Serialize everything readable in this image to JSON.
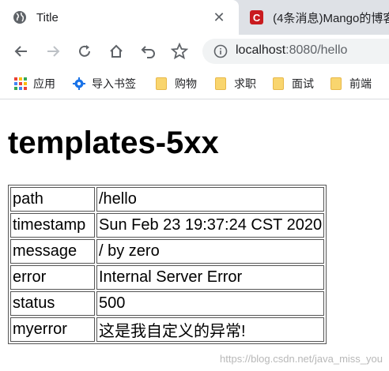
{
  "tabs": [
    {
      "title": "Title",
      "close": "✕"
    },
    {
      "title": "(4条消息)Mango的博客",
      "favicon_text": "C"
    }
  ],
  "omnibox": {
    "host": "localhost",
    "port_path": ":8080/hello"
  },
  "bookmarks": [
    {
      "label": "应用",
      "icon": "apps-grid-icon"
    },
    {
      "label": "导入书签",
      "icon": "gear-icon"
    },
    {
      "label": "购物",
      "icon": "folder-icon"
    },
    {
      "label": "求职",
      "icon": "folder-icon"
    },
    {
      "label": "面试",
      "icon": "folder-icon"
    },
    {
      "label": "前端",
      "icon": "folder-icon"
    }
  ],
  "page": {
    "heading": "templates-5xx",
    "rows": [
      {
        "key": "path",
        "value": "/hello"
      },
      {
        "key": "timestamp",
        "value": "Sun Feb 23 19:37:24 CST 2020"
      },
      {
        "key": "message",
        "value": "/ by zero"
      },
      {
        "key": "error",
        "value": "Internal Server Error"
      },
      {
        "key": "status",
        "value": "500"
      },
      {
        "key": "myerror",
        "value": "这是我自定义的异常!"
      }
    ],
    "watermark": "https://blog.csdn.net/java_miss_you"
  }
}
